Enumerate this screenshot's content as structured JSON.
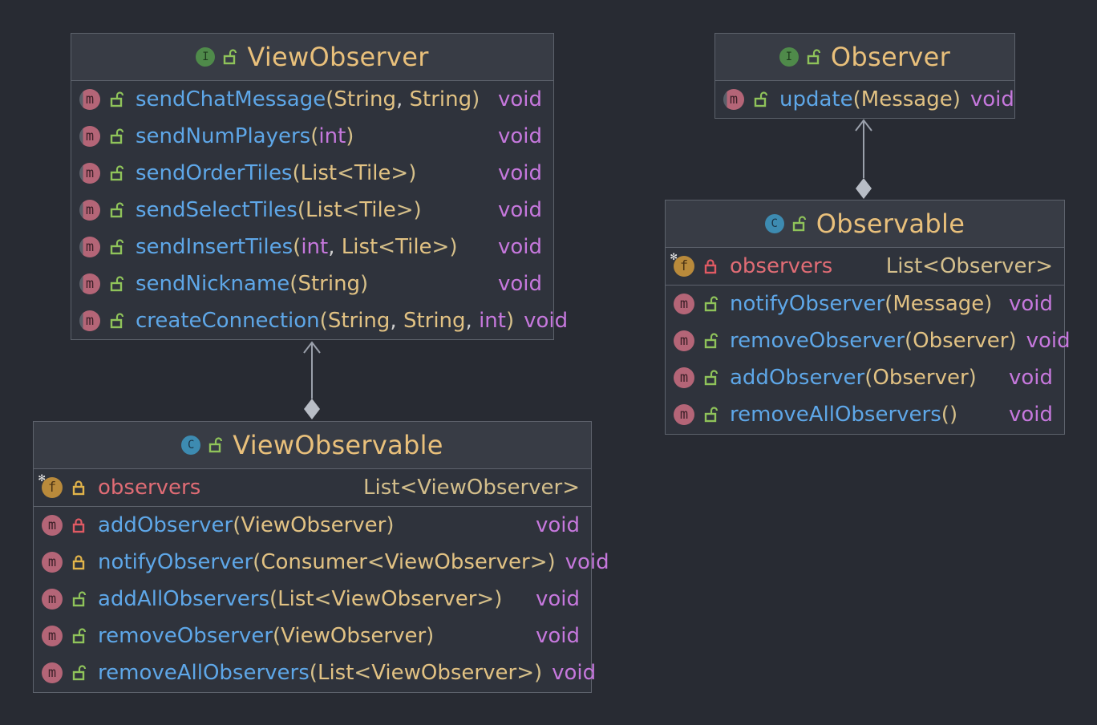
{
  "boxes": {
    "view_observer": {
      "name": "ViewObserver",
      "badge": "I",
      "methods": [
        {
          "name": "sendChatMessage",
          "params": [
            [
              "type",
              "String"
            ],
            [
              "type",
              "String"
            ]
          ],
          "ret": "void"
        },
        {
          "name": "sendNumPlayers",
          "params": [
            [
              "kw",
              "int"
            ]
          ],
          "ret": "void"
        },
        {
          "name": "sendOrderTiles",
          "params": [
            [
              "type",
              "List<Tile>"
            ]
          ],
          "ret": "void"
        },
        {
          "name": "sendSelectTiles",
          "params": [
            [
              "type",
              "List<Tile>"
            ]
          ],
          "ret": "void"
        },
        {
          "name": "sendInsertTiles",
          "params": [
            [
              "kw",
              "int"
            ],
            [
              "type",
              "List<Tile>"
            ]
          ],
          "ret": "void"
        },
        {
          "name": "sendNickname",
          "params": [
            [
              "type",
              "String"
            ]
          ],
          "ret": "void"
        },
        {
          "name": "createConnection",
          "params": [
            [
              "type",
              "String"
            ],
            [
              "type",
              "String"
            ],
            [
              "kw",
              "int"
            ]
          ],
          "ret": "void"
        }
      ]
    },
    "observer": {
      "name": "Observer",
      "badge": "I",
      "methods": [
        {
          "name": "update",
          "params": [
            [
              "type",
              "Message"
            ]
          ],
          "ret": "void"
        }
      ]
    },
    "observable": {
      "name": "Observable",
      "badge": "C",
      "field": {
        "name": "observers",
        "type": "List<Observer>"
      },
      "methods": [
        {
          "name": "notifyObserver",
          "params": [
            [
              "type",
              "Message"
            ]
          ],
          "ret": "void"
        },
        {
          "name": "removeObserver",
          "params": [
            [
              "type",
              "Observer"
            ]
          ],
          "ret": "void"
        },
        {
          "name": "addObserver",
          "params": [
            [
              "type",
              "Observer"
            ]
          ],
          "ret": "void"
        },
        {
          "name": "removeAllObservers",
          "params": [],
          "ret": "void"
        }
      ]
    },
    "view_observable": {
      "name": "ViewObservable",
      "badge": "C",
      "field": {
        "name": "observers",
        "type": "List<ViewObserver>"
      },
      "methods": [
        {
          "name": "addObserver",
          "params": [
            [
              "type",
              "ViewObserver"
            ]
          ],
          "ret": "void",
          "lock": "private"
        },
        {
          "name": "notifyObserver",
          "params": [
            [
              "type",
              "Consumer<ViewObserver>"
            ]
          ],
          "ret": "void",
          "lock": "private-yellow"
        },
        {
          "name": "addAllObservers",
          "params": [
            [
              "type",
              "List<ViewObserver>"
            ]
          ],
          "ret": "void"
        },
        {
          "name": "removeObserver",
          "params": [
            [
              "type",
              "ViewObserver"
            ]
          ],
          "ret": "void"
        },
        {
          "name": "removeAllObservers",
          "params": [
            [
              "type",
              "List<ViewObserver>"
            ]
          ],
          "ret": "void"
        }
      ]
    }
  },
  "colors": {
    "background": "#282b33",
    "box": "#2f333c",
    "header": "#383c45",
    "border": "#5d626c",
    "class_name": "#e9c07b",
    "method_name": "#5ea7e8",
    "field_name": "#e06c75",
    "return_type": "#c678dd",
    "param_type": "#e2c283",
    "arrow": "#9aa0ab"
  },
  "icons": {
    "interface": "interface-badge-icon",
    "class": "class-badge-icon",
    "method": "method-badge-icon",
    "field": "field-badge-icon",
    "public": "open-lock-icon",
    "private": "closed-lock-icon",
    "relation": "diamond-arrow-icon"
  }
}
